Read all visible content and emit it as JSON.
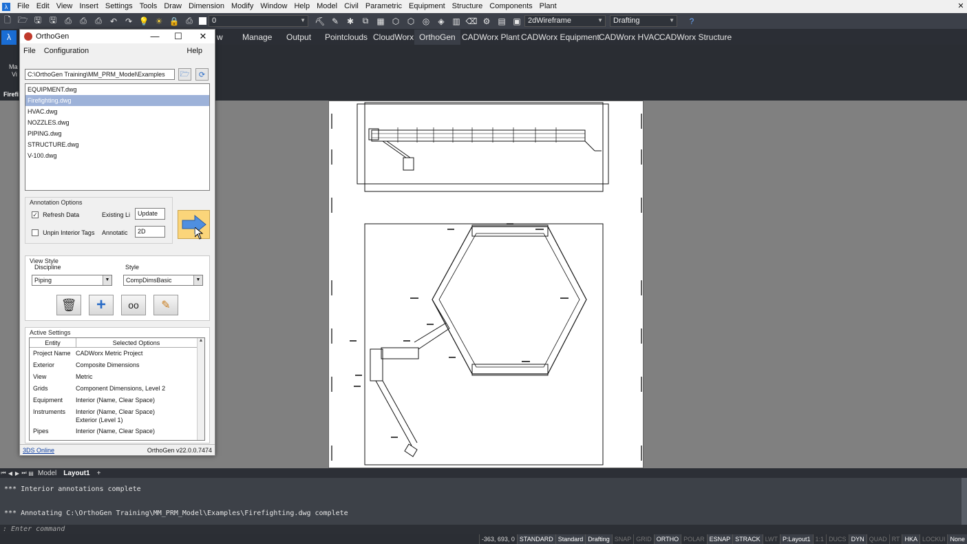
{
  "menubar": {
    "items": [
      "File",
      "Edit",
      "View",
      "Insert",
      "Settings",
      "Tools",
      "Draw",
      "Dimension",
      "Modify",
      "Window",
      "Help",
      "Model",
      "Civil",
      "Parametric",
      "Equipment",
      "Structure",
      "Components",
      "Plant"
    ]
  },
  "toolbar": {
    "layer_value": "0",
    "visual_style": "2dWireframe",
    "workspace": "Drafting"
  },
  "ribbon": {
    "tabs": [
      "w",
      "Manage",
      "Output",
      "Pointclouds",
      "CloudWorx",
      "OrthoGen",
      "CADWorx Plant",
      "CADWorx Equipment",
      "CADWorx HVAC",
      "CADWorx Structure"
    ],
    "active_tab": "OrthoGen",
    "left_fragments": [
      "Ma",
      "Vi",
      "Firefi"
    ]
  },
  "orthogen": {
    "title": "OrthoGen",
    "menu": {
      "file": "File",
      "configuration": "Configuration",
      "help": "Help"
    },
    "path": "C:\\OrthoGen Training\\MM_PRM_Model\\Examples",
    "files": [
      "EQUIPMENT.dwg",
      "Firefighting.dwg",
      "HVAC.dwg",
      "NOZZLES.dwg",
      "PIPING.dwg",
      "STRUCTURE.dwg",
      "V-100.dwg"
    ],
    "selected_file": "Firefighting.dwg",
    "annotation": {
      "title": "Annotation Options",
      "refresh_label": "Refresh Data",
      "refresh_checked": true,
      "unpin_label": "Unpin Interior Tags",
      "unpin_checked": false,
      "existing_label": "Existing Li",
      "existing_value": "Update",
      "annotation_label": "Annotatic",
      "annotation_value": "2D"
    },
    "view_style": {
      "title": "View Style",
      "discipline_label": "Discipline",
      "discipline_value": "Piping",
      "style_label": "Style",
      "style_value": "CompDimsBasic"
    },
    "active_settings": {
      "title": "Active Settings",
      "col_entity": "Entity",
      "col_options": "Selected Options",
      "rows": [
        {
          "k": "Project Name",
          "v": "CADWorx Metric Project"
        },
        {
          "k": "Exterior",
          "v": "Composite Dimensions"
        },
        {
          "k": "View",
          "v": "Metric"
        },
        {
          "k": "Grids",
          "v": "Component Dimensions, Level 2"
        },
        {
          "k": "Equipment",
          "v": "Interior (Name, Clear Space)"
        },
        {
          "k": "Instruments",
          "v": "Interior (Name, Clear Space)",
          "v2": "Exterior (Level 1)"
        },
        {
          "k": "Pipes",
          "v": "Interior (Name, Clear Space)"
        }
      ]
    },
    "footer": {
      "link": "3DS Online",
      "version": "OrthoGen v22.0.0.7474"
    }
  },
  "layout_tabs": {
    "model": "Model",
    "layout1": "Layout1",
    "add": "+"
  },
  "command": {
    "line1": "*** Interior annotations complete",
    "line2": "*** Annotating C:\\OrthoGen Training\\MM_PRM_Model\\Examples\\Firefighting.dwg complete",
    "prompt": ": Enter command"
  },
  "statusbar": {
    "coords": "-363, 693, 0",
    "items": [
      "STANDARD",
      "Standard",
      "Drafting",
      "SNAP",
      "GRID",
      "ORTHO",
      "POLAR",
      "ESNAP",
      "STRACK",
      "LWT",
      "P:Layout1",
      "1:1",
      "DUCS",
      "DYN",
      "QUAD",
      "RT",
      "HKA",
      "LOCKUI",
      "None"
    ],
    "on": [
      "STANDARD",
      "Standard",
      "Drafting",
      "ORTHO",
      "ESNAP",
      "STRACK",
      "P:Layout1",
      "DYN",
      "HKA",
      "None"
    ]
  },
  "colors": {
    "accent": "#1c6fd6",
    "selection": "#9db2d9",
    "run_button": "#fbd57a"
  }
}
